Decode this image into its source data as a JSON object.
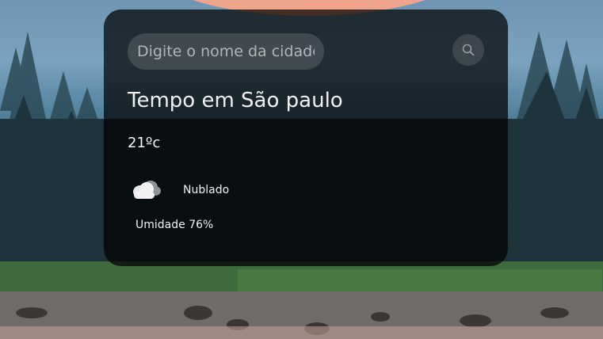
{
  "search": {
    "placeholder": "Digite o nome da cidade",
    "value": ""
  },
  "weather": {
    "title": "Tempo em São paulo",
    "temperature": "21ºc",
    "condition": "Nublado",
    "condition_icon": "cloudy-icon",
    "humidity": "Umidade 76%"
  },
  "icons": {
    "search_button": "search-icon"
  },
  "colors": {
    "card_background": "#000000b8",
    "text": "#ffffff",
    "input_background": "#ffffff24"
  }
}
